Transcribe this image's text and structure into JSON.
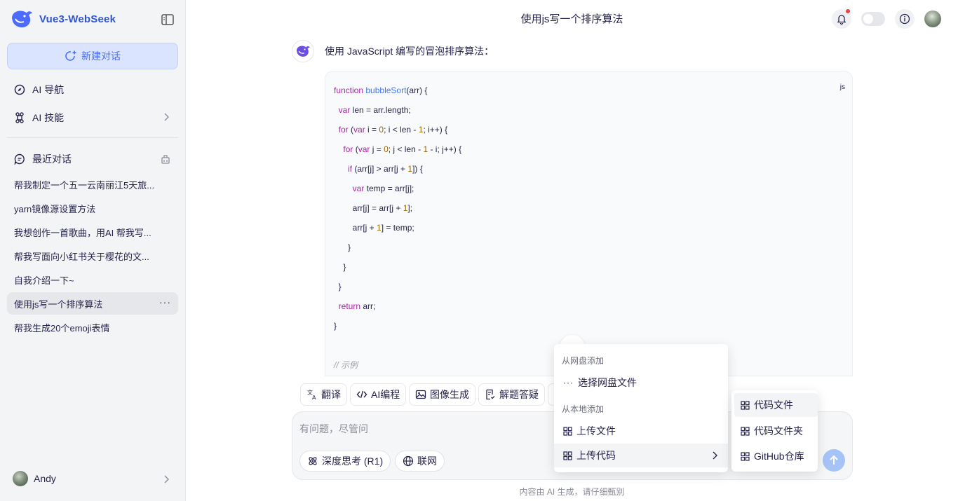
{
  "brand": {
    "name": "Vue3-WebSeek"
  },
  "sidebar": {
    "new_chat": "新建对话",
    "nav": [
      {
        "label": "AI 导航"
      },
      {
        "label": "AI 技能"
      }
    ],
    "recent_title": "最近对话",
    "history": [
      "帮我制定一个五一云南丽江5天旅...",
      "yarn镜像源设置方法",
      "我想创作一首歌曲，用AI 帮我写...",
      "帮我写面向小红书关于樱花的文...",
      "自我介绍一下~",
      "使用js写一个排序算法",
      "帮我生成20个emoji表情"
    ],
    "active_index": 5,
    "more": "···",
    "user_name": "Andy"
  },
  "header": {
    "title": "使用js写一个排序算法"
  },
  "message": {
    "intro": "使用 JavaScript 编写的冒泡排序算法：",
    "code_lang": "js"
  },
  "quick_actions": [
    "翻译",
    "AI编程",
    "图像生成",
    "解题答疑"
  ],
  "input": {
    "placeholder": "有问题，尽管问",
    "deep_think": "深度思考 (R1)",
    "web": "联网"
  },
  "footer": {
    "note": "内容由 AI 生成，请仔细甄别"
  },
  "menu": {
    "group_cloud": "从网盘添加",
    "cloud_pick": "选择网盘文件",
    "group_local": "从本地添加",
    "upload_file": "上传文件",
    "upload_code": "上传代码",
    "sub": [
      "代码文件",
      "代码文件夹",
      "GitHub仓库"
    ]
  },
  "colors": {
    "accent": "#4c6ef5",
    "brand": "#2f55d4",
    "send": "#a6c3f7"
  }
}
